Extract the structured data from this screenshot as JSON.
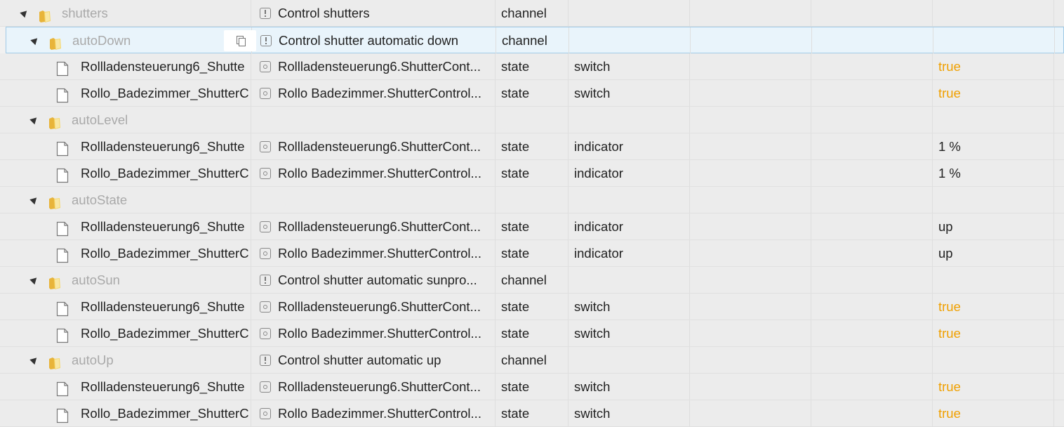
{
  "rows": [
    {
      "kind": "folder",
      "level": 0,
      "name": "shutters",
      "desc": "Control shutters",
      "desc_icon": "channel-icon",
      "type": "channel",
      "role": "",
      "value": ""
    },
    {
      "kind": "folder",
      "level": 1,
      "name": "autoDown",
      "desc": "Control shutter automatic down",
      "desc_icon": "channel-icon",
      "type": "channel",
      "role": "",
      "value": "",
      "selected": true
    },
    {
      "kind": "file",
      "level": 2,
      "name": "Rollladensteuerung6_Shutte",
      "desc": "Rollladensteuerung6.ShutterCont...",
      "desc_icon": "state-icon",
      "type": "state",
      "role": "switch",
      "value": "true"
    },
    {
      "kind": "file",
      "level": 2,
      "name": "Rollo_Badezimmer_ShutterC",
      "desc": "Rollo Badezimmer.ShutterControl...",
      "desc_icon": "state-icon",
      "type": "state",
      "role": "switch",
      "value": "true"
    },
    {
      "kind": "folder",
      "level": 1,
      "name": "autoLevel",
      "desc": "",
      "desc_icon": "",
      "type": "",
      "role": "",
      "value": ""
    },
    {
      "kind": "file",
      "level": 2,
      "name": "Rollladensteuerung6_Shutte",
      "desc": "Rollladensteuerung6.ShutterCont...",
      "desc_icon": "state-icon",
      "type": "state",
      "role": "indicator",
      "value": "1 %"
    },
    {
      "kind": "file",
      "level": 2,
      "name": "Rollo_Badezimmer_ShutterC",
      "desc": "Rollo Badezimmer.ShutterControl...",
      "desc_icon": "state-icon",
      "type": "state",
      "role": "indicator",
      "value": "1 %"
    },
    {
      "kind": "folder",
      "level": 1,
      "name": "autoState",
      "desc": "",
      "desc_icon": "",
      "type": "",
      "role": "",
      "value": ""
    },
    {
      "kind": "file",
      "level": 2,
      "name": "Rollladensteuerung6_Shutte",
      "desc": "Rollladensteuerung6.ShutterCont...",
      "desc_icon": "state-icon",
      "type": "state",
      "role": "indicator",
      "value": "up"
    },
    {
      "kind": "file",
      "level": 2,
      "name": "Rollo_Badezimmer_ShutterC",
      "desc": "Rollo Badezimmer.ShutterControl...",
      "desc_icon": "state-icon",
      "type": "state",
      "role": "indicator",
      "value": "up"
    },
    {
      "kind": "folder",
      "level": 1,
      "name": "autoSun",
      "desc": "Control shutter automatic sunpro...",
      "desc_icon": "channel-icon",
      "type": "channel",
      "role": "",
      "value": ""
    },
    {
      "kind": "file",
      "level": 2,
      "name": "Rollladensteuerung6_Shutte",
      "desc": "Rollladensteuerung6.ShutterCont...",
      "desc_icon": "state-icon",
      "type": "state",
      "role": "switch",
      "value": "true"
    },
    {
      "kind": "file",
      "level": 2,
      "name": "Rollo_Badezimmer_ShutterC",
      "desc": "Rollo Badezimmer.ShutterControl...",
      "desc_icon": "state-icon",
      "type": "state",
      "role": "switch",
      "value": "true"
    },
    {
      "kind": "folder",
      "level": 1,
      "name": "autoUp",
      "desc": "Control shutter automatic up",
      "desc_icon": "channel-icon",
      "type": "channel",
      "role": "",
      "value": ""
    },
    {
      "kind": "file",
      "level": 2,
      "name": "Rollladensteuerung6_Shutte",
      "desc": "Rollladensteuerung6.ShutterCont...",
      "desc_icon": "state-icon",
      "type": "state",
      "role": "switch",
      "value": "true"
    },
    {
      "kind": "file",
      "level": 2,
      "name": "Rollo_Badezimmer_ShutterC",
      "desc": "Rollo Badezimmer.ShutterControl...",
      "desc_icon": "state-icon",
      "type": "state",
      "role": "switch",
      "value": "true"
    }
  ],
  "copy_button_icon": "copy-icon",
  "colors": {
    "value_true": "#f0a000",
    "folder_label": "#a9a9a9",
    "selected_bg": "#e9f4fb",
    "selected_border": "#9fc9e6"
  }
}
